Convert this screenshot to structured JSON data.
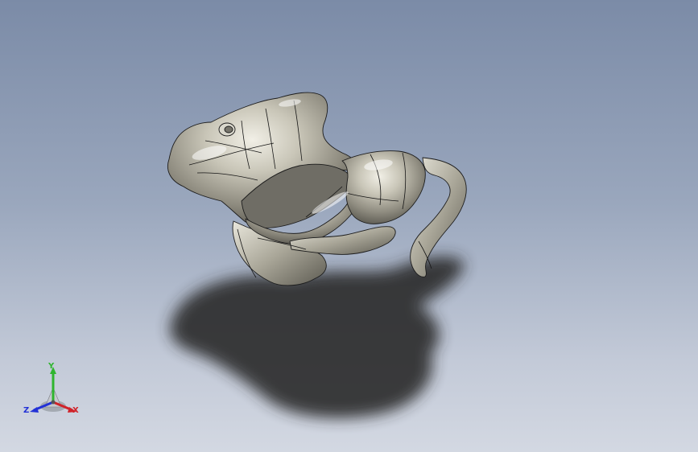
{
  "viewport": {
    "background_top": "#7b8ba7",
    "background_bottom": "#d3d8e2",
    "model_color": "#b8b5a7",
    "shadow_color": "#2a2a2c"
  },
  "triad": {
    "x_label": "X",
    "y_label": "Y",
    "z_label": "Z",
    "x_color": "#d0232a",
    "y_color": "#2fb52f",
    "z_color": "#2231d6"
  }
}
